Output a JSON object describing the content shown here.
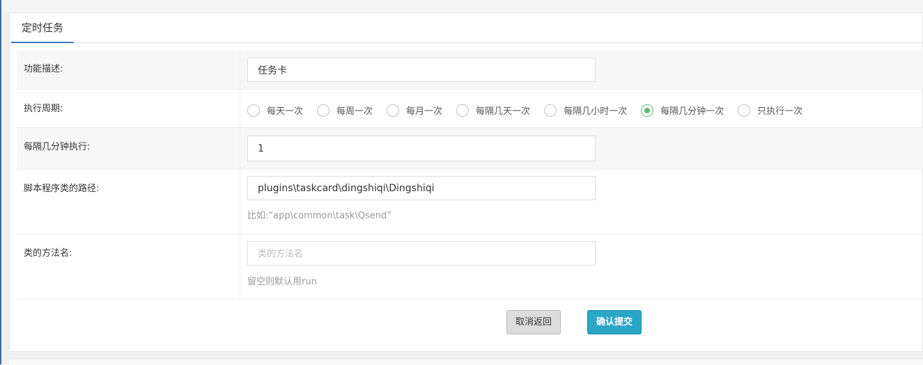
{
  "tab": {
    "label": "定时任务"
  },
  "form": {
    "description": {
      "label": "功能描述:",
      "value": "任务卡"
    },
    "cycle": {
      "label": "执行周期:",
      "options": [
        "每天一次",
        "每周一次",
        "每月一次",
        "每隔几天一次",
        "每隔几小时一次",
        "每隔几分钟一次",
        "只执行一次"
      ],
      "selected": "每隔几分钟一次"
    },
    "interval": {
      "label": "每隔几分钟执行:",
      "value": "1"
    },
    "class_path": {
      "label": "脚本程序类的路径:",
      "value": "plugins\\taskcard\\dingshiqi\\Dingshiqi",
      "hint": "比如:“app\\common\\task\\Qsend”"
    },
    "method": {
      "label": "类的方法名:",
      "value": "",
      "placeholder": "类的方法名",
      "hint": "留空则默认用run"
    }
  },
  "buttons": {
    "cancel_label": "取消返回",
    "submit_label": "确认提交"
  },
  "colors": {
    "accent": "#2aa6c7",
    "radio_checked": "#5fb878",
    "tab_underline": "#3a7bbf"
  }
}
